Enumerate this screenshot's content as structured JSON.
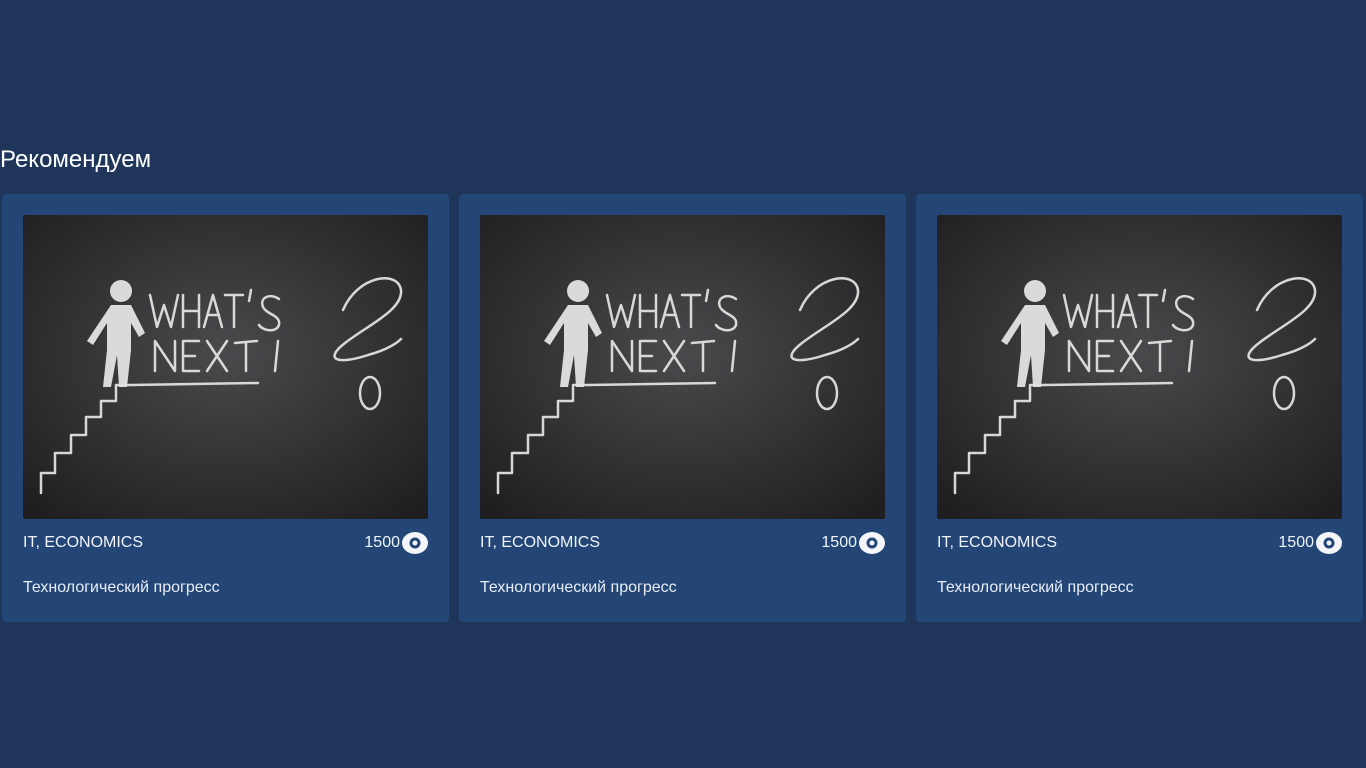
{
  "section": {
    "title": "Рекомендуем"
  },
  "cards": [
    {
      "image_alt": "WHAT'S NEXT",
      "tags": "IT, ECONOMICS",
      "views": "1500",
      "title": "Технологический прогресс",
      "view_icon": "eye-icon"
    },
    {
      "image_alt": "WHAT'S NEXT",
      "tags": "IT, ECONOMICS",
      "views": "1500",
      "title": "Технологический прогресс",
      "view_icon": "eye-icon"
    },
    {
      "image_alt": "WHAT'S NEXT",
      "tags": "IT, ECONOMICS",
      "views": "1500",
      "title": "Технологический прогресс",
      "view_icon": "eye-icon"
    }
  ],
  "colors": {
    "background": "#1f365a",
    "card": "#234676",
    "text": "#ffffff"
  }
}
